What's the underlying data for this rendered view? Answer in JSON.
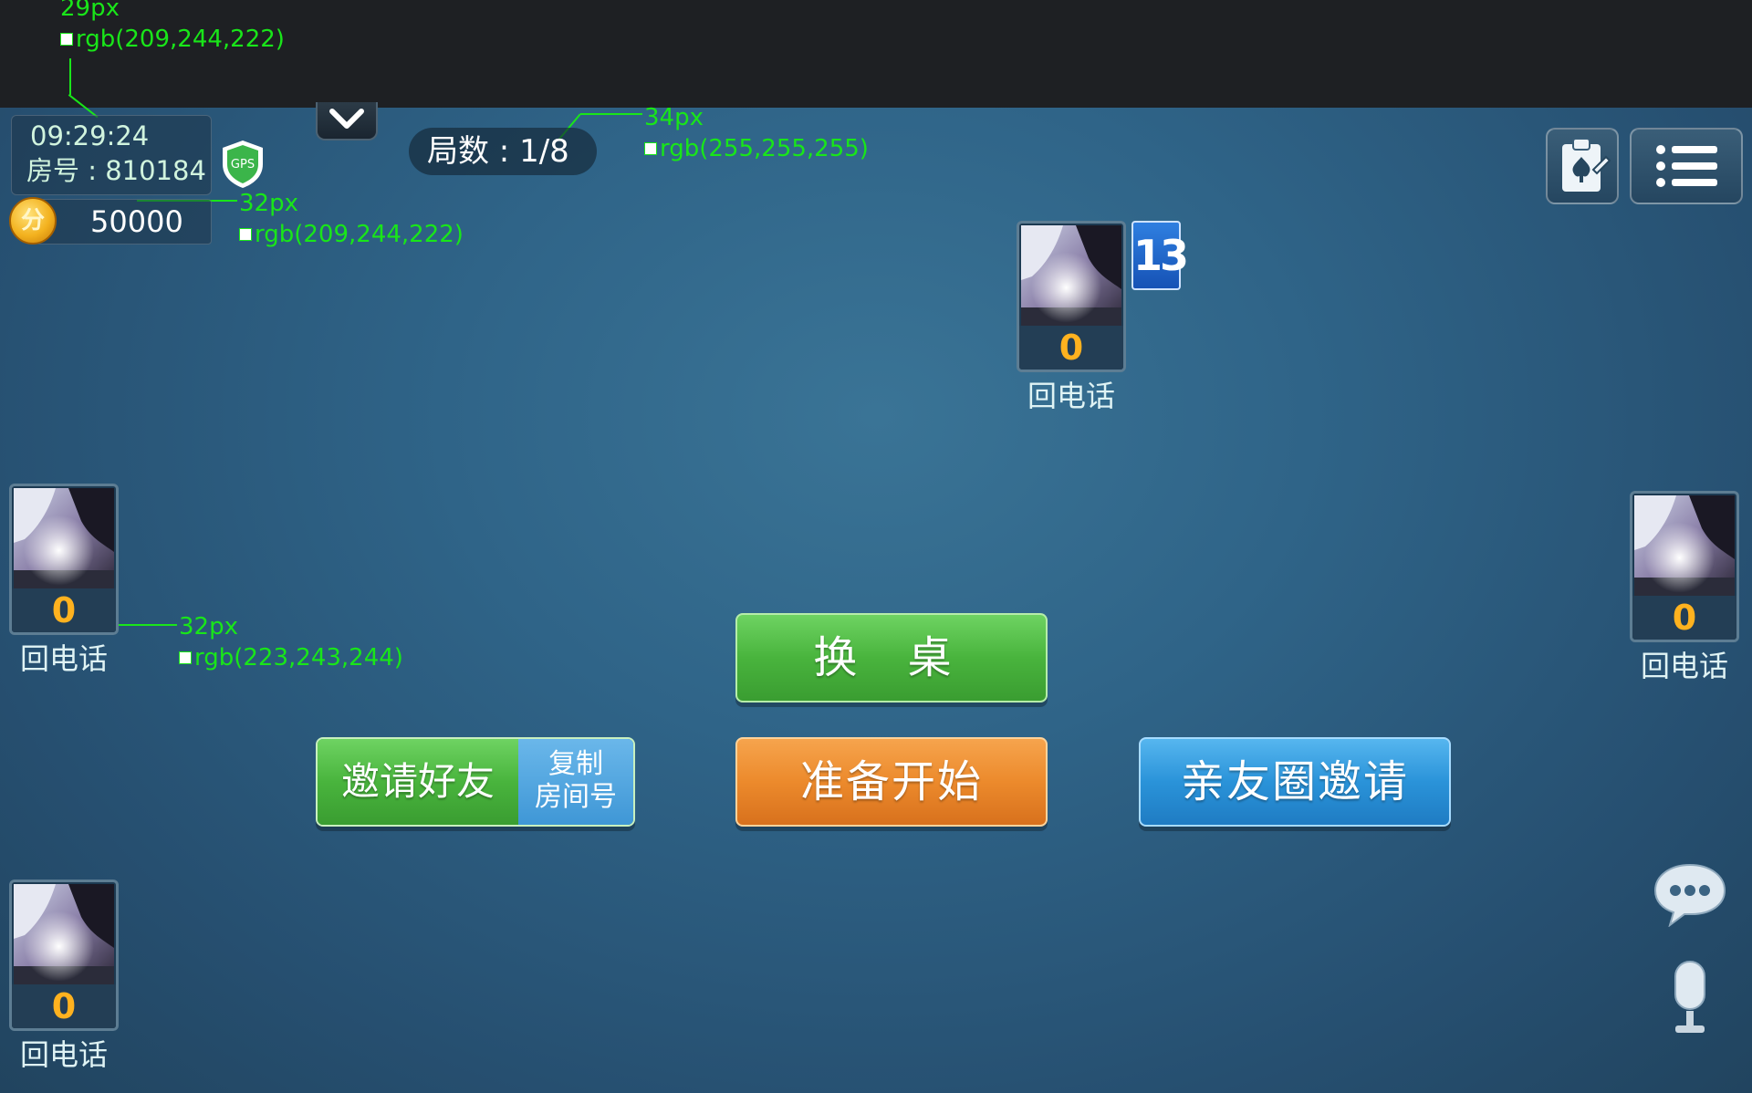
{
  "annotations": {
    "top_size": "29px",
    "top_color": "rgb(209,244,222)",
    "round_size": "34px",
    "round_color": "rgb(255,255,255)",
    "score_size": "32px",
    "score_color": "rgb(209,244,222)",
    "name_size": "32px",
    "name_color": "rgb(223,243,244)"
  },
  "header": {
    "time": "09:29:24",
    "room": "房号 : 810184",
    "score": "50000",
    "coin_label": "分",
    "gps_label": "GPS",
    "round": "局数 : 1/8"
  },
  "seats": {
    "top": {
      "score": "0",
      "name": "回电话",
      "card_count": "13"
    },
    "left": {
      "score": "0",
      "name": "回电话"
    },
    "right": {
      "score": "0",
      "name": "回电话"
    },
    "bottom": {
      "score": "0",
      "name": "回电话"
    }
  },
  "buttons": {
    "switch_table": "换 桌",
    "ready": "准备开始",
    "invite_friends": "邀请好友",
    "copy_line1": "复制",
    "copy_line2": "房间号",
    "circle_invite": "亲友圈邀请"
  },
  "icons": {
    "clipboard": "clipboard-icon",
    "menu": "menu-icon",
    "chat": "chat-icon",
    "mic": "microphone-icon",
    "dropdown": "chevron-down-icon"
  },
  "colors": {
    "table": "#2f6488",
    "score_gold": "#ffb21f",
    "green": "#49b43d",
    "orange": "#ec8a2c",
    "blue": "#2a93d9"
  }
}
